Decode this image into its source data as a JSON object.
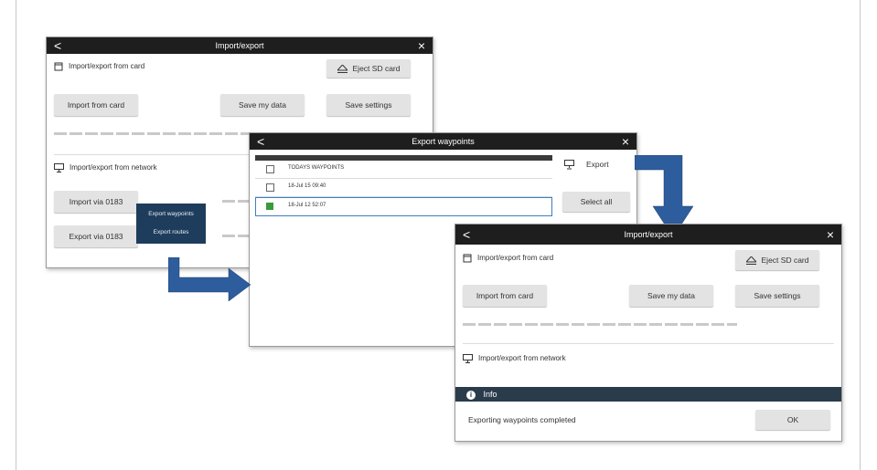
{
  "window1": {
    "title": "Import/export",
    "back_glyph": "<",
    "close_glyph": "×",
    "card_section": "Import/export from card",
    "eject_label": "Eject SD card",
    "import_card": "Import from card",
    "save_data": "Save my data",
    "save_settings": "Save settings",
    "network_section": "Import/export from network",
    "import_0183": "Import via 0183",
    "export_0183": "Export via 0183",
    "popup_items": [
      "Export waypoints",
      "Export routes"
    ]
  },
  "window2": {
    "title": "Export waypoints",
    "back_glyph": "<",
    "close_glyph": "×",
    "rows": [
      {
        "name": "TODAYS WAYPOINTS",
        "checked": false
      },
      {
        "name": "18-Jul 15 09:40",
        "checked": false
      },
      {
        "name": "18-Jul 12 52:07",
        "checked": true
      }
    ],
    "export_label": "Export",
    "select_all": "Select all"
  },
  "window3": {
    "title": "Import/export",
    "back_glyph": "<",
    "close_glyph": "×",
    "card_section": "Import/export from card",
    "eject_label": "Eject SD card",
    "import_card": "Import from card",
    "save_data": "Save my data",
    "save_settings": "Save settings",
    "network_section": "Import/export from network",
    "info_title": "Info",
    "info_message": "Exporting waypoints completed",
    "ok_label": "OK"
  },
  "colors": {
    "titlebar": "#1e1e1e",
    "button": "#e3e3e3",
    "popup": "#1e3d5c",
    "info_bar": "#2a3b4c",
    "arrow": "#2d5d9c",
    "check": "#3a9a3a"
  }
}
